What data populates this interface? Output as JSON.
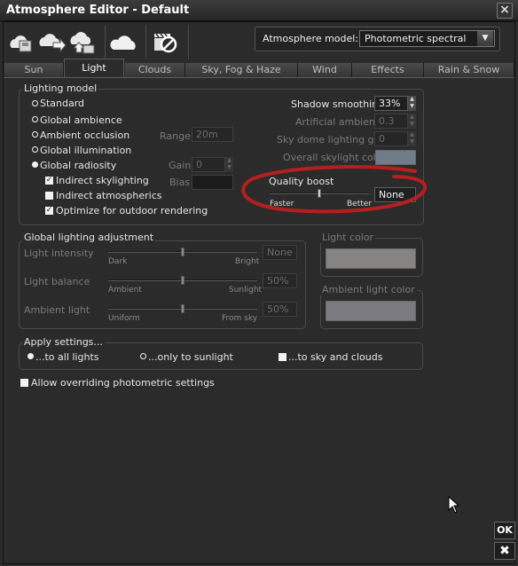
{
  "window": {
    "title": "Atmosphere Editor - Default",
    "close_icon": "close-icon"
  },
  "toolbar": {
    "icons": [
      "load-atmosphere-icon",
      "save-atmosphere-icon",
      "atmosphere-library-icon",
      "cloud-icon",
      "no-animation-icon"
    ],
    "atmosphere_model_label": "Atmosphere model:",
    "atmosphere_model_value": "Photometric spectral"
  },
  "tabs": [
    {
      "label": "Sun",
      "active": false
    },
    {
      "label": "Light",
      "active": true
    },
    {
      "label": "Clouds",
      "active": false
    },
    {
      "label": "Sky, Fog & Haze",
      "active": false
    },
    {
      "label": "Wind",
      "active": false
    },
    {
      "label": "Effects",
      "active": false
    },
    {
      "label": "Rain & Snow",
      "active": false
    }
  ],
  "lighting_model": {
    "title": "Lighting model",
    "options": [
      {
        "label": "Standard",
        "selected": false
      },
      {
        "label": "Global ambience",
        "selected": false
      },
      {
        "label": "Ambient occlusion",
        "selected": false
      },
      {
        "label": "Global illumination",
        "selected": false
      },
      {
        "label": "Global radiosity",
        "selected": true
      }
    ],
    "checkboxes": [
      {
        "label": "Indirect skylighting",
        "checked": true
      },
      {
        "label": "Indirect atmospherics",
        "checked": false
      },
      {
        "label": "Optimize for outdoor rendering",
        "checked": true
      }
    ],
    "range_label": "Range",
    "range_value": "20m",
    "gain_label": "Gain",
    "gain_value": "0",
    "bias_label": "Bias",
    "bias_value": "",
    "shadow_smoothing_label": "Shadow smoothing",
    "shadow_smoothing_value": "33%",
    "artificial_ambience_label": "Artificial ambience",
    "artificial_ambience_value": "0.3",
    "sky_dome_gain_label": "Sky dome lighting gain",
    "sky_dome_gain_value": "0",
    "overall_skylight_label": "Overall skylight color",
    "overall_skylight_color": "#6e7d89",
    "quality_boost_label": "Quality boost",
    "quality_faster": "Faster",
    "quality_better": "Better",
    "quality_value": "None",
    "quality_level": 0.5
  },
  "annotation_color": "#b51f1f",
  "global_adjustment": {
    "title": "Global lighting adjustment",
    "rows": [
      {
        "label": "Light intensity",
        "min": "Dark",
        "max": "Bright",
        "value": "None",
        "level": 0.5
      },
      {
        "label": "Light balance",
        "min": "Ambient",
        "max": "Sunlight",
        "value": "50%",
        "level": 0.5
      },
      {
        "label": "Ambient light",
        "min": "Uniform",
        "max": "From sky",
        "value": "50%",
        "level": 0.5
      }
    ]
  },
  "light_color": {
    "label": "Light color",
    "color": "#858482"
  },
  "ambient_light_color": {
    "label": "Ambient light color",
    "color": "#7a7a80"
  },
  "apply_settings": {
    "title": "Apply settings...",
    "all_lights": "...to all lights",
    "only_sunlight": "...only to sunlight",
    "sky_and_clouds": "...to sky and clouds",
    "selected": "all_lights"
  },
  "allow_override_label": "Allow overriding photometric settings",
  "ok_label": "OK",
  "cancel_icon": "cancel-icon"
}
